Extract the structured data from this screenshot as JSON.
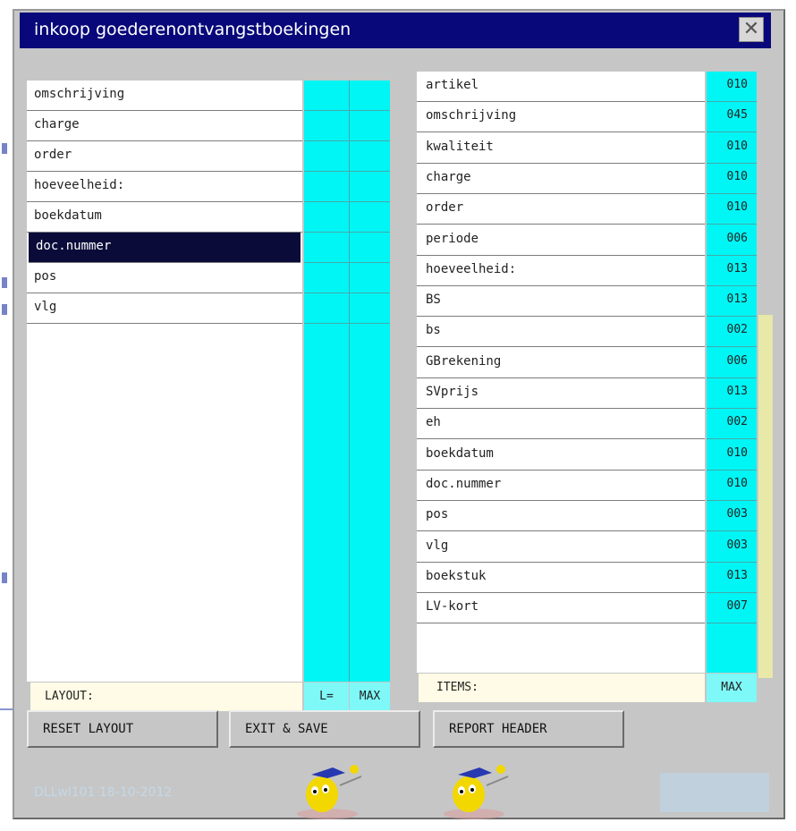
{
  "window": {
    "title": "inkoop goederenontvangstboekingen",
    "close_glyph": "✕"
  },
  "left_panel": {
    "rows": [
      "omschrijving",
      "charge",
      "order",
      "hoeveelheid:",
      "boekdatum",
      "doc.nummer",
      "pos",
      "vlg"
    ],
    "selected_index": 5,
    "footer": {
      "layout_label": "LAYOUT:",
      "length_label": "L=",
      "max_label": "MAX"
    }
  },
  "right_panel": {
    "rows": [
      {
        "name": "artikel",
        "max": "010"
      },
      {
        "name": "omschrijving",
        "max": "045"
      },
      {
        "name": "kwaliteit",
        "max": "010"
      },
      {
        "name": "charge",
        "max": "010"
      },
      {
        "name": "order",
        "max": "010"
      },
      {
        "name": "periode",
        "max": "006"
      },
      {
        "name": "hoeveelheid:",
        "max": "013"
      },
      {
        "name": "BS",
        "max": "013"
      },
      {
        "name": "bs",
        "max": "002"
      },
      {
        "name": "GBrekening",
        "max": "006"
      },
      {
        "name": "SVprijs",
        "max": "013"
      },
      {
        "name": "eh",
        "max": "002"
      },
      {
        "name": "boekdatum",
        "max": "010"
      },
      {
        "name": "doc.nummer",
        "max": "010"
      },
      {
        "name": "pos",
        "max": "003"
      },
      {
        "name": "vlg",
        "max": "003"
      },
      {
        "name": "boekstuk",
        "max": "013"
      },
      {
        "name": "LV-kort",
        "max": "007"
      }
    ],
    "footer": {
      "items_label": "ITEMS:",
      "max_label": "MAX"
    }
  },
  "buttons": {
    "reset_layout": "RESET LAYOUT",
    "exit_save": "EXIT & SAVE",
    "report_header": "REPORT HEADER"
  },
  "footer": {
    "version_text": "DLLwl101 18-10-2012"
  },
  "colors": {
    "titlebar": "#08087a",
    "cyan_column": "#00f5f5",
    "selected_row": "#0b0b3a",
    "label_bg": "#fffbe6",
    "dialog_bg": "#c6c6c6"
  }
}
